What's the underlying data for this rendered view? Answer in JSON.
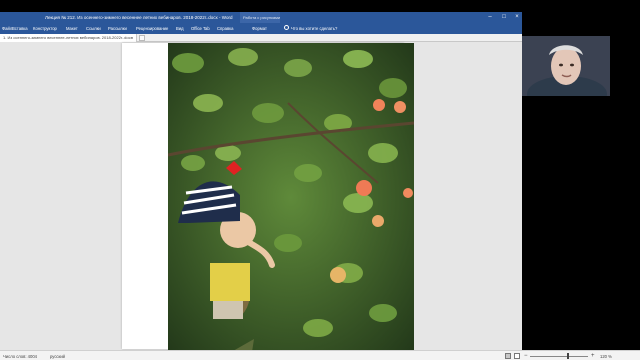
{
  "window": {
    "title": "Лекция № 212. Из осеннего-зимнего весеннее летних вебинаров. 2018-2022г..docx - Word",
    "context_group_label": "Работа с рисунками"
  },
  "ribbon": {
    "tabs": [
      "Файл",
      "Вставка",
      "Конструктор",
      "Макет",
      "Ссылки",
      "Рассылки",
      "Рецензирование",
      "Вид",
      "Office Tab",
      "Справка",
      "Формат"
    ],
    "tell_me": "Что вы хотите сделать?"
  },
  "doc_tab": {
    "label": "1. Из осеннего-зимнего весеннее-летних вебинаров. 2018-2022г..docx",
    "close": "×"
  },
  "statusbar": {
    "word_count": "Число слов: 4004",
    "language": "русский",
    "zoom": "120 %",
    "zoom_minus": "−",
    "zoom_plus": "+"
  },
  "icons": {
    "photo": "child-apricot-tree-photo",
    "webcam": "webcam-presenter-feed"
  },
  "colors": {
    "title_bar": "#2b579a",
    "page": "#ffffff",
    "canvas": "#e6e6e6"
  }
}
